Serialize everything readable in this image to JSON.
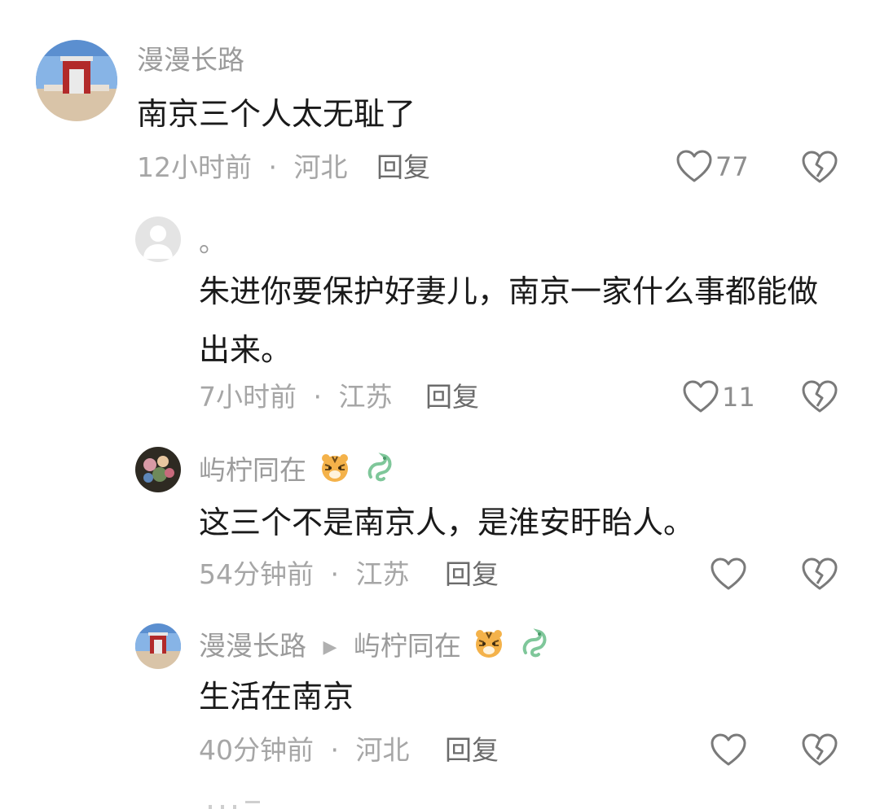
{
  "comments": [
    {
      "username": "漫漫长路",
      "text": "南京三个人太无耻了",
      "time": "12小时前",
      "separator": "·",
      "location": "河北",
      "reply_label": "回复",
      "likes": "77"
    },
    {
      "username": "。",
      "text": "朱进你要保护好妻儿，南京一家什么事都能做出来。",
      "time": "7小时前",
      "separator": "·",
      "location": "江苏",
      "reply_label": "回复",
      "likes": "11"
    },
    {
      "username": "屿柠同在",
      "badges": [
        "tiger-badge-icon",
        "dragon-badge-icon"
      ],
      "text": "这三个不是南京人，是淮安盱眙人。",
      "time": "54分钟前",
      "separator": "·",
      "location": "江苏",
      "reply_label": "回复",
      "likes": ""
    },
    {
      "username": "漫漫长路",
      "reply_to": "屿柠同在",
      "badges": [
        "tiger-badge-icon",
        "dragon-badge-icon"
      ],
      "text": "生活在南京",
      "time": "40分钟前",
      "separator": "·",
      "location": "河北",
      "reply_label": "回复",
      "likes": ""
    }
  ],
  "colors": {
    "text": "#1a1a1a",
    "username": "#9b9b9b",
    "meta": "#a6a6a6",
    "icon": "#7a7a7a",
    "dragon": "#7fc79a",
    "tiger": "#f4b24a"
  }
}
